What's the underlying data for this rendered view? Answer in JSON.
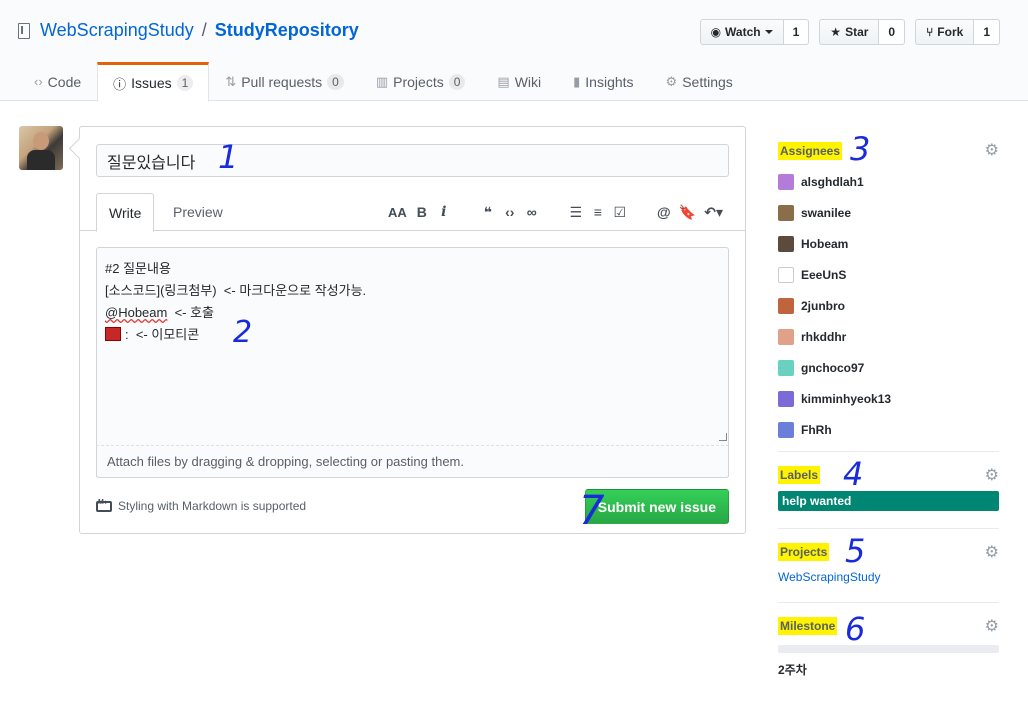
{
  "repo": {
    "owner": "WebScrapingStudy",
    "separator": "/",
    "name": "StudyRepository"
  },
  "actions": {
    "watch": {
      "label": "Watch",
      "count": "1"
    },
    "star": {
      "label": "Star",
      "count": "0"
    },
    "fork": {
      "label": "Fork",
      "count": "1"
    }
  },
  "nav": [
    {
      "label": "Code",
      "icon": "code-icon"
    },
    {
      "label": "Issues",
      "count": "1",
      "icon": "issue-opened-icon"
    },
    {
      "label": "Pull requests",
      "count": "0",
      "icon": "git-pull-request-icon"
    },
    {
      "label": "Projects",
      "count": "0",
      "icon": "project-icon"
    },
    {
      "label": "Wiki",
      "icon": "book-icon"
    },
    {
      "label": "Insights",
      "icon": "graph-icon"
    },
    {
      "label": "Settings",
      "icon": "gear-icon"
    }
  ],
  "form": {
    "title_value": "질문있습니다",
    "tabs": {
      "write": "Write",
      "preview": "Preview"
    },
    "toolbar": [
      "header-icon",
      "bold-icon",
      "italic-icon",
      "quote-icon",
      "code-icon",
      "link-icon",
      "unordered-list-icon",
      "ordered-list-icon",
      "tasklist-icon",
      "mention-icon",
      "reference-icon",
      "reply-icon"
    ],
    "body_lines": [
      "#2 질문내용",
      "[소스코드](링크첨부)  <- 마크다운으로 작성가능.",
      "@Hobeam",
      "  <- 호출",
      ":  <- 이모티콘"
    ],
    "attach_hint": "Attach files by dragging & dropping, selecting or pasting them.",
    "markdown_note": "Styling with Markdown is supported",
    "submit_label": "Submit new issue"
  },
  "sidebar": {
    "assignees": {
      "heading": "Assignees",
      "people": [
        {
          "login": "alsghdlah1",
          "color": "#b57bd8"
        },
        {
          "login": "swanilee",
          "color": "#8a6d4a"
        },
        {
          "login": "Hobeam",
          "color": "#5c4a3d"
        },
        {
          "login": "EeeUnS",
          "color": "#ffffff"
        },
        {
          "login": "2junbro",
          "color": "#c0643e"
        },
        {
          "login": "rhkddhr",
          "color": "#e0a08a"
        },
        {
          "login": "gnchoco97",
          "color": "#6ad0c0"
        },
        {
          "login": "kimminhyeok13",
          "color": "#7b6bd6"
        },
        {
          "login": "FhRh",
          "color": "#6b7fd8"
        }
      ]
    },
    "labels": {
      "heading": "Labels",
      "items": [
        {
          "name": "help wanted",
          "color": "#008672"
        }
      ]
    },
    "projects": {
      "heading": "Projects",
      "value": "WebScrapingStudy"
    },
    "milestone": {
      "heading": "Milestone",
      "value": "2주차"
    }
  },
  "annotations": [
    "1",
    "2",
    "3",
    "4",
    "5",
    "6",
    "7"
  ]
}
